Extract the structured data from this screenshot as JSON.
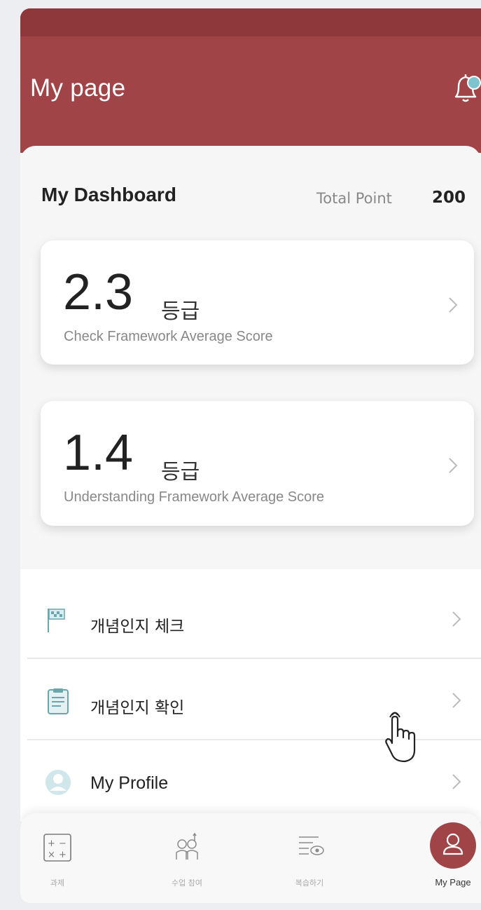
{
  "header": {
    "title": "My page",
    "bell_icon": "notification-bell-icon"
  },
  "dashboard": {
    "title": "My Dashboard",
    "total_point_label": "Total Point",
    "total_point_value": "200"
  },
  "cards": [
    {
      "score": "2.3",
      "unit": "등급",
      "subtitle": "Check Framework Average Score"
    },
    {
      "score": "1.4",
      "unit": "등급",
      "subtitle": "Understanding Framework Average Score"
    }
  ],
  "menu": [
    {
      "label": "개념인지 체크",
      "icon": "flag-icon"
    },
    {
      "label": "개념인지 확인",
      "icon": "checklist-icon"
    },
    {
      "label": "My Profile",
      "icon": "profile-icon"
    }
  ],
  "tabs": [
    {
      "label": "과제",
      "icon": "calculator-icon"
    },
    {
      "label": "수업 참여",
      "icon": "raise-hand-icon"
    },
    {
      "label": "복습하기",
      "icon": "review-icon"
    },
    {
      "label": "My Page",
      "icon": "user-icon",
      "active": true
    }
  ],
  "colors": {
    "brand": "#a04448",
    "header_band": "#8e383c",
    "accent_teal": "#5aa8b0"
  }
}
